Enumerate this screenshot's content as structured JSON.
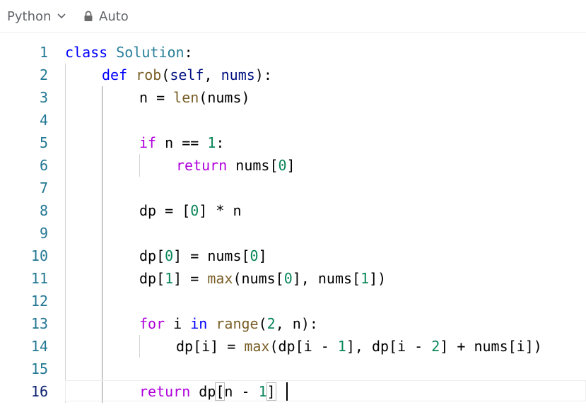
{
  "toolbar": {
    "language": "Python",
    "mode": "Auto"
  },
  "editor": {
    "lines": [
      {
        "number": "1"
      },
      {
        "number": "2"
      },
      {
        "number": "3"
      },
      {
        "number": "4"
      },
      {
        "number": "5"
      },
      {
        "number": "6"
      },
      {
        "number": "7"
      },
      {
        "number": "8"
      },
      {
        "number": "9"
      },
      {
        "number": "10"
      },
      {
        "number": "11"
      },
      {
        "number": "12"
      },
      {
        "number": "13"
      },
      {
        "number": "14"
      },
      {
        "number": "15"
      },
      {
        "number": "16"
      }
    ],
    "current_line": "16",
    "tokens": {
      "l1": [
        "class",
        " ",
        "Solution",
        ":"
      ],
      "l2": [
        "def",
        " ",
        "rob",
        "(",
        "self",
        ", ",
        "nums",
        "):"
      ],
      "l3": [
        "n = ",
        "len",
        "(nums)"
      ],
      "l5": [
        "if",
        " n == ",
        "1",
        ":"
      ],
      "l6": [
        "return",
        " nums[",
        "0",
        "]"
      ],
      "l8": [
        "dp = [",
        "0",
        "] * n"
      ],
      "l10": [
        "dp[",
        "0",
        "] = nums[",
        "0",
        "]"
      ],
      "l11": [
        "dp[",
        "1",
        "] = ",
        "max",
        "(nums[",
        "0",
        "], nums[",
        "1",
        "])"
      ],
      "l13": [
        "for",
        " i ",
        "in",
        " ",
        "range",
        "(",
        "2",
        ", n):"
      ],
      "l14": [
        "dp[i] = ",
        "max",
        "(dp[i - ",
        "1",
        "], dp[i - ",
        "2",
        "] + nums[i])"
      ],
      "l16": [
        "return",
        " dp",
        "[",
        "n - ",
        "1",
        "]"
      ]
    }
  },
  "colors": {
    "keyword": "#0000ff",
    "control_keyword": "#af00db",
    "class_name": "#267f99",
    "function": "#795e26",
    "number": "#098658",
    "parameter": "#001080",
    "line_number": "#237893"
  },
  "icons": {
    "language_dropdown": "chevron-down-icon",
    "mode": "lock-icon"
  }
}
